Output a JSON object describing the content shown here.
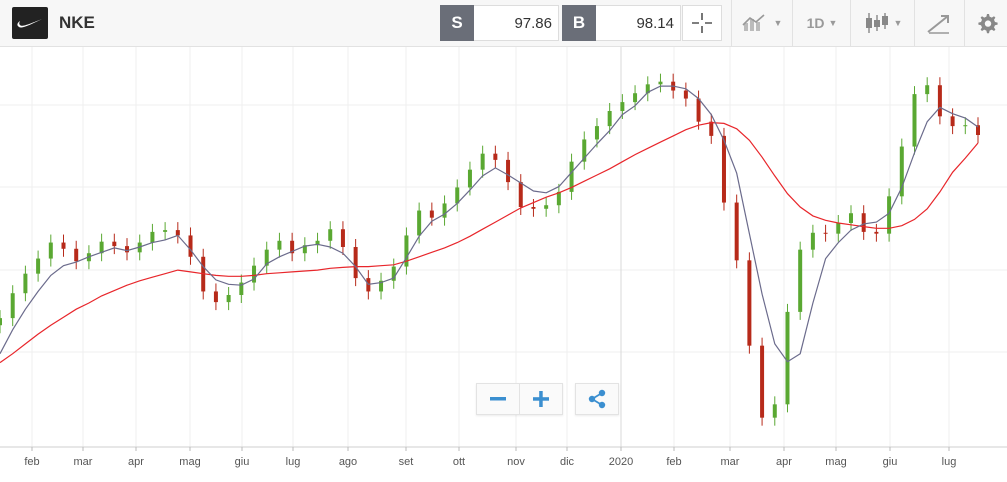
{
  "header": {
    "logo_icon": "nike-swoosh-icon",
    "ticker": "NKE",
    "sell_label": "S",
    "sell_price": "97.86",
    "buy_label": "B",
    "buy_price": "98.14",
    "crosshair_icon": "crosshair-icon",
    "indicators_icon": "indicators-icon",
    "timeframe": "1D",
    "chart_type_icon": "candlestick-icon",
    "draw_icon": "draw-tools-icon",
    "settings_icon": "gear-icon"
  },
  "controls": {
    "zoom_out_icon": "minus-icon",
    "zoom_in_icon": "plus-icon",
    "share_icon": "share-icon"
  },
  "colors": {
    "up": "#5aa832",
    "down": "#b72a1a",
    "ma_fast": "#6b6b8c",
    "ma_slow": "#e8262b",
    "grid": "#efefef"
  },
  "chart_data": {
    "type": "candlestick",
    "x_tick_labels": [
      "feb",
      "mar",
      "apr",
      "mag",
      "giu",
      "lug",
      "ago",
      "set",
      "ott",
      "nov",
      "dic",
      "2020",
      "feb",
      "mar",
      "apr",
      "mag",
      "giu",
      "lug"
    ],
    "x": [
      "2019-01-25",
      "2019-02-01",
      "2019-02-08",
      "2019-02-15",
      "2019-02-22",
      "2019-03-01",
      "2019-03-08",
      "2019-03-15",
      "2019-03-22",
      "2019-03-29",
      "2019-04-05",
      "2019-04-12",
      "2019-04-19",
      "2019-04-26",
      "2019-05-03",
      "2019-05-10",
      "2019-05-17",
      "2019-05-24",
      "2019-05-31",
      "2019-06-07",
      "2019-06-14",
      "2019-06-21",
      "2019-06-28",
      "2019-07-05",
      "2019-07-12",
      "2019-07-19",
      "2019-07-26",
      "2019-08-02",
      "2019-08-09",
      "2019-08-16",
      "2019-08-23",
      "2019-08-30",
      "2019-09-06",
      "2019-09-13",
      "2019-09-20",
      "2019-09-27",
      "2019-10-04",
      "2019-10-11",
      "2019-10-18",
      "2019-10-25",
      "2019-11-01",
      "2019-11-08",
      "2019-11-15",
      "2019-11-22",
      "2019-11-29",
      "2019-12-06",
      "2019-12-13",
      "2019-12-20",
      "2019-12-27",
      "2020-01-03",
      "2020-01-10",
      "2020-01-17",
      "2020-01-24",
      "2020-01-31",
      "2020-02-07",
      "2020-02-14",
      "2020-02-21",
      "2020-02-28",
      "2020-03-06",
      "2020-03-13",
      "2020-03-20",
      "2020-03-27",
      "2020-04-03",
      "2020-04-10",
      "2020-04-17",
      "2020-04-24",
      "2020-05-01",
      "2020-05-08",
      "2020-05-15",
      "2020-05-22",
      "2020-05-29",
      "2020-06-05",
      "2020-06-12",
      "2020-06-19",
      "2020-06-26",
      "2020-07-03",
      "2020-07-10",
      "2020-07-17"
    ],
    "close": [
      77.5,
      80.3,
      82.5,
      84.2,
      86.0,
      85.3,
      83.9,
      84.8,
      86.1,
      85.6,
      84.9,
      86.0,
      87.2,
      87.4,
      86.8,
      84.4,
      80.5,
      79.3,
      80.1,
      81.5,
      83.4,
      85.2,
      86.2,
      84.8,
      85.7,
      86.2,
      87.5,
      85.5,
      82.0,
      80.5,
      81.7,
      83.3,
      86.8,
      89.6,
      88.8,
      90.4,
      92.2,
      94.2,
      96.0,
      95.3,
      92.8,
      90.0,
      89.8,
      90.2,
      91.7,
      95.1,
      97.6,
      99.1,
      100.8,
      101.8,
      102.8,
      103.8,
      104.1,
      103.1,
      102.2,
      99.6,
      98.0,
      90.5,
      84.0,
      74.4,
      66.3,
      67.8,
      78.2,
      85.2,
      87.1,
      87.0,
      88.2,
      89.3,
      87.2,
      87.0,
      91.2,
      96.8,
      102.7,
      103.7,
      100.2,
      99.1,
      99.2,
      98.1
    ],
    "ma_fast": [
      73.5,
      76.2,
      78.5,
      80.5,
      82.3,
      83.4,
      83.8,
      84.4,
      84.9,
      85.4,
      85.1,
      85.5,
      86.0,
      86.3,
      86.8,
      85.2,
      83.3,
      81.8,
      81.3,
      81.2,
      81.9,
      83.6,
      84.4,
      85.0,
      85.6,
      85.8,
      85.5,
      84.8,
      83.3,
      81.3,
      81.5,
      82.0,
      84.3,
      86.7,
      88.4,
      89.2,
      90.4,
      91.9,
      93.5,
      94.4,
      93.6,
      92.7,
      91.8,
      91.6,
      92.3,
      93.9,
      95.5,
      97.1,
      98.6,
      100.4,
      101.4,
      102.9,
      103.6,
      103.6,
      103.3,
      102.2,
      100.4,
      97.5,
      93.8,
      87.0,
      80.2,
      74.6,
      72.6,
      73.5,
      79.2,
      84.2,
      86.0,
      87.4,
      88.1,
      88.3,
      89.3,
      92.2,
      96.1,
      99.6,
      101.2,
      100.5,
      100.0,
      99.0
    ],
    "ma_slow": [
      72.5,
      73.5,
      74.6,
      75.7,
      76.7,
      77.6,
      78.5,
      79.2,
      80.0,
      80.6,
      81.2,
      81.7,
      82.1,
      82.5,
      82.9,
      82.7,
      82.5,
      82.3,
      82.2,
      82.2,
      82.3,
      82.5,
      82.6,
      82.7,
      82.8,
      82.9,
      83.1,
      83.2,
      83.3,
      83.3,
      83.4,
      83.5,
      83.9,
      84.4,
      84.9,
      85.4,
      86.0,
      86.7,
      87.5,
      88.3,
      89.1,
      89.9,
      90.5,
      91.1,
      91.6,
      92.2,
      92.9,
      93.6,
      94.3,
      95.1,
      95.9,
      96.6,
      97.3,
      98.0,
      98.7,
      99.2,
      99.5,
      99.4,
      98.8,
      97.5,
      95.6,
      93.5,
      91.5,
      90.0,
      89.0,
      88.5,
      88.2,
      88.0,
      87.8,
      87.6,
      87.6,
      87.9,
      88.6,
      89.8,
      91.7,
      93.9,
      95.5,
      97.2
    ],
    "ylim": [
      63,
      108
    ],
    "grid": true,
    "legend": "none"
  }
}
